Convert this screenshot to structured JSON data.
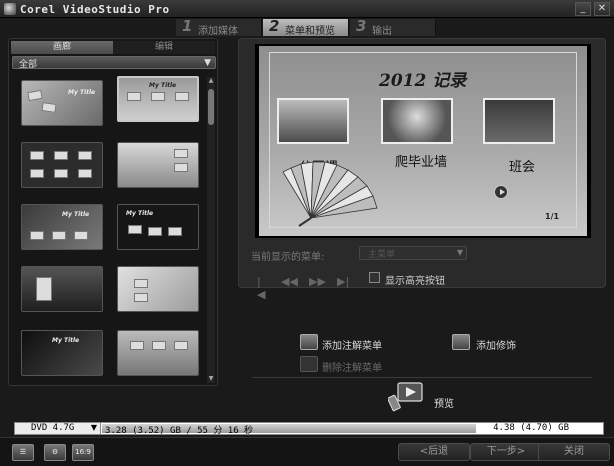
{
  "window": {
    "title": "Corel VideoStudio Pro",
    "minimize_glyph": "_",
    "close_glyph": "✕"
  },
  "steps": [
    {
      "num": "1",
      "label": "添加媒体"
    },
    {
      "num": "2",
      "label": "菜单和预览"
    },
    {
      "num": "3",
      "label": "输出"
    }
  ],
  "left_panel": {
    "tabs": [
      "画廊",
      "编辑"
    ],
    "filter": "全部",
    "thumbnail_title": "My Title"
  },
  "menu_preview": {
    "title": "2012  记录",
    "clips": [
      {
        "label": "公开课"
      },
      {
        "label": "爬毕业墙"
      },
      {
        "label": "班会"
      }
    ],
    "page": "1/1"
  },
  "current_menu": {
    "label": "当前显示的菜单:",
    "value": "主菜单"
  },
  "nav_controls": [
    "|◀",
    "◀◀",
    "▶▶",
    "▶|"
  ],
  "show_highlight": {
    "label": "显示高亮按钮",
    "checked": false
  },
  "actions": {
    "add_note_menu": "添加注解菜单",
    "delete_note_menu": "删除注解菜单",
    "add_decoration": "添加修饰",
    "preview": "预览"
  },
  "capacity": {
    "disc": "DVD 4.7G",
    "used_text": "3.28 (3.52) GB / 55 分 16 秒",
    "max_text": "4.38 (4.70) GB",
    "used_fraction": 0.75
  },
  "bottom": {
    "back": "<后退",
    "next": "下一步>",
    "close": "关闭",
    "ratio_badge": "16:9"
  }
}
